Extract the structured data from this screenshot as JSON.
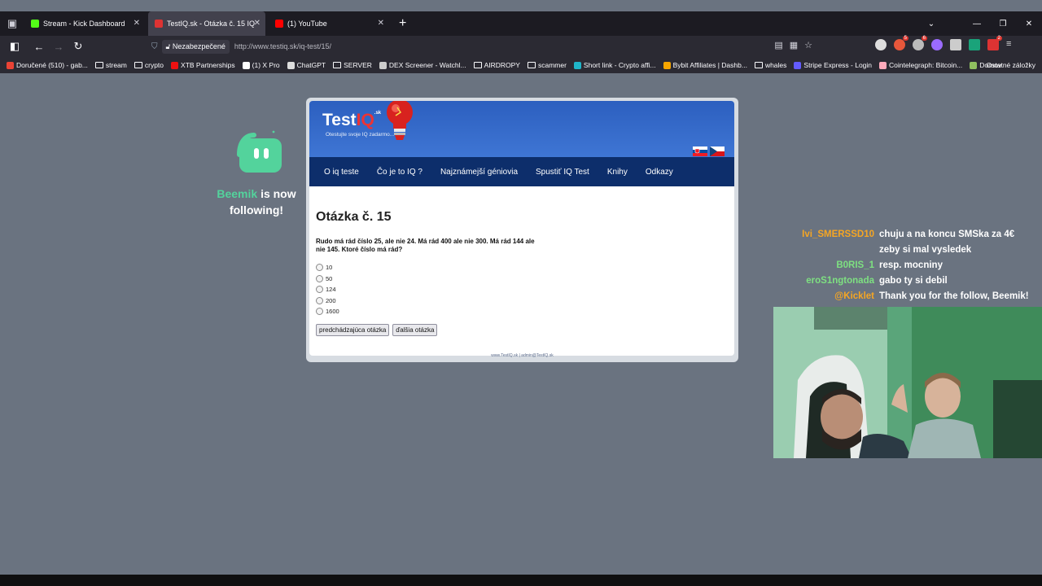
{
  "browser": {
    "tabs": [
      {
        "title": "Stream - Kick Dashboard",
        "active": false,
        "favicon_color": "#53fc18"
      },
      {
        "title": "TestIQ.sk - Otázka č. 15 IQ Test",
        "active": true,
        "favicon_color": "#d33"
      },
      {
        "title": "(1) YouTube",
        "active": false,
        "favicon_color": "#ff0000"
      }
    ],
    "security_label": "Nezabezpečené",
    "url": "http://www.testiq.sk/iq-test/15/",
    "bookmarks": [
      {
        "label": "Doručené (510) - gab...",
        "icon": "gmail-icon",
        "color": "#ea4335"
      },
      {
        "label": "stream",
        "icon": "folder-icon"
      },
      {
        "label": "crypto",
        "icon": "folder-icon"
      },
      {
        "label": "XTB Partnerships",
        "icon": "xtb-icon",
        "color": "#e11"
      },
      {
        "label": "(1) X Pro",
        "icon": "x-icon",
        "color": "#fff"
      },
      {
        "label": "ChatGPT",
        "icon": "chatgpt-icon",
        "color": "#ddd"
      },
      {
        "label": "SERVER",
        "icon": "folder-icon"
      },
      {
        "label": "DEX Screener - Watchl...",
        "icon": "dex-icon",
        "color": "#ccc"
      },
      {
        "label": "AIRDROPY",
        "icon": "folder-icon"
      },
      {
        "label": "scammer",
        "icon": "folder-icon"
      },
      {
        "label": "Short link - Crypto affi...",
        "icon": "link-icon",
        "color": "#1fb5c9"
      },
      {
        "label": "Bybit Affiliates | Dashb...",
        "icon": "bybit-icon",
        "color": "#f7a600"
      },
      {
        "label": "whales",
        "icon": "folder-icon"
      },
      {
        "label": "Stripe Express - Login",
        "icon": "stripe-icon",
        "color": "#635bff"
      },
      {
        "label": "Cointelegraph: Bitcoin...",
        "icon": "cointelegraph-icon",
        "color": "#fab"
      },
      {
        "label": "Domov",
        "icon": "home-icon",
        "color": "#8fbf5f"
      }
    ],
    "other_bookmarks": "Ostatné záložky"
  },
  "site": {
    "logo_text": "Test",
    "logo_iq": "IQ",
    "logo_suffix": ".sk",
    "logo_tagline": "Otestujte svoje IQ zadarmo...",
    "menu": [
      "O iq teste",
      "Čo je to IQ ?",
      "Najznámejší géniovia",
      "Spustiť IQ Test",
      "Knihy",
      "Odkazy"
    ],
    "question_title": "Otázka č. 15",
    "question_text": "Rudo má rád číslo 25, ale nie 24. Má rád 400 ale nie 300. Má rád 144 ale nie 145. Ktoré číslo má rád?",
    "options": [
      "10",
      "50",
      "124",
      "200",
      "1600"
    ],
    "prev_button": "predchádzajúca otázka",
    "next_button": "ďalšia otázka",
    "footer": "www.TestIQ.sk | admin@TestIQ.sk"
  },
  "overlay": {
    "follower_name": "Beemik",
    "follow_text": "is now following!",
    "chat": [
      {
        "user": "Ivi_SMERSSD10",
        "user_color": "#f5a623",
        "text": "chuju a na koncu SMSka za 4€ zeby si mal vysledek"
      },
      {
        "user": "B0RIS_1",
        "user_color": "#7ee081",
        "text": "resp. mocniny"
      },
      {
        "user": "eroS1ngtonada",
        "user_color": "#7ee081",
        "text": "gabo ty si debil"
      },
      {
        "user": "@Kicklet",
        "user_color": "#f5a623",
        "text": "Thank you for the follow, Beemik!"
      }
    ]
  }
}
